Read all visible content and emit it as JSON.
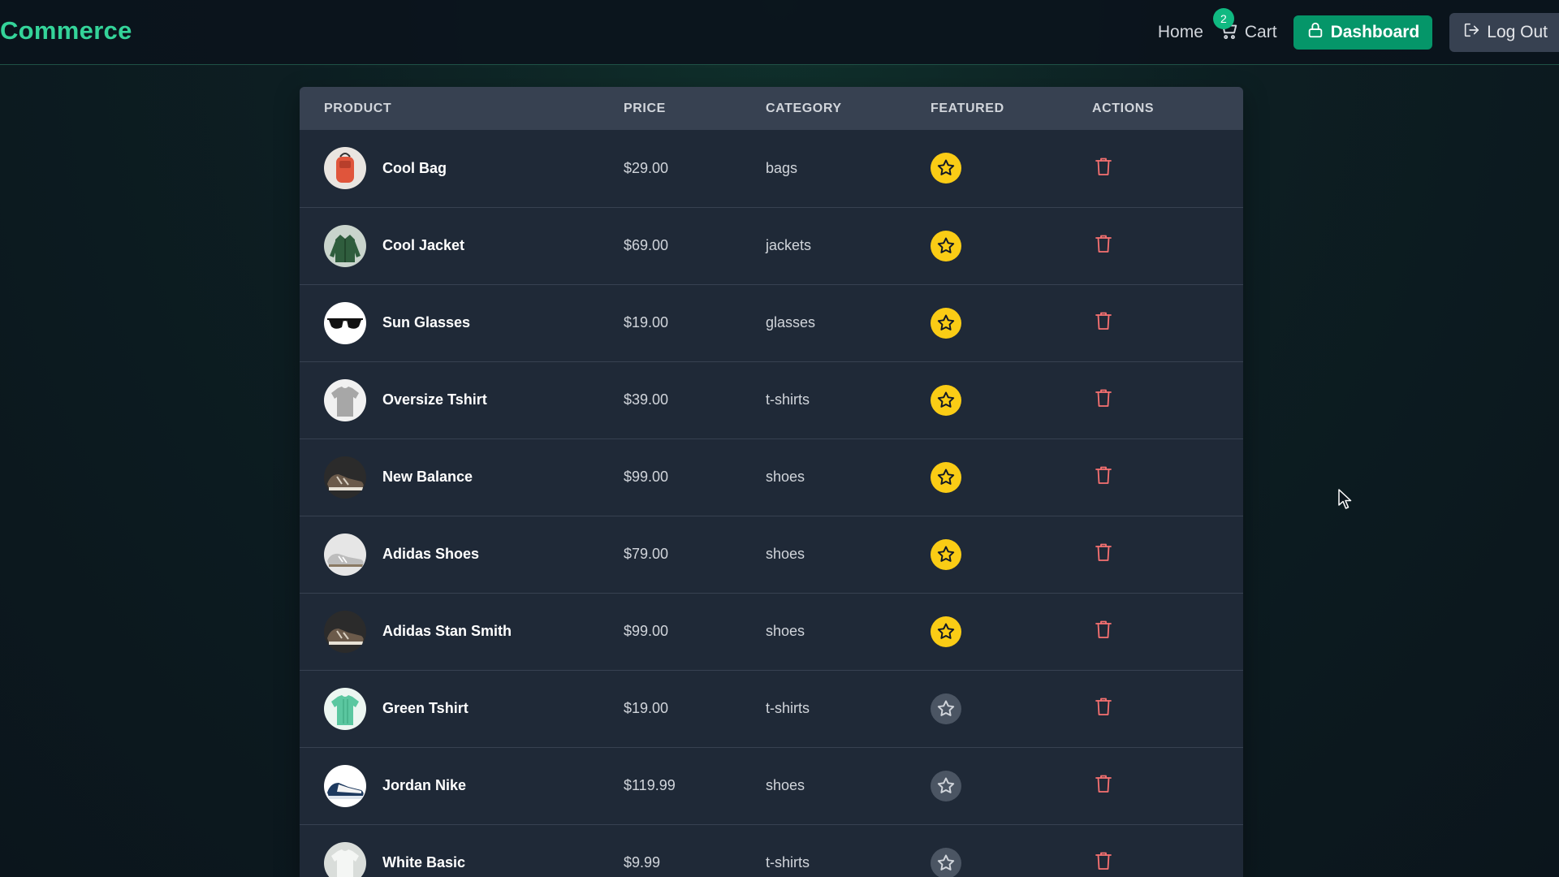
{
  "nav": {
    "brand": "Commerce",
    "home_label": "Home",
    "cart_label": "Cart",
    "cart_count": "2",
    "dashboard_label": "Dashboard",
    "logout_label": "Log Out"
  },
  "table": {
    "headers": {
      "product": "PRODUCT",
      "price": "PRICE",
      "category": "CATEGORY",
      "featured": "FEATURED",
      "actions": "ACTIONS"
    },
    "rows": [
      {
        "name": "Cool Bag",
        "price": "$29.00",
        "category": "bags",
        "featured": true,
        "thumb": "bag"
      },
      {
        "name": "Cool Jacket",
        "price": "$69.00",
        "category": "jackets",
        "featured": true,
        "thumb": "jacket"
      },
      {
        "name": "Sun Glasses",
        "price": "$19.00",
        "category": "glasses",
        "featured": true,
        "thumb": "glasses"
      },
      {
        "name": "Oversize Tshirt",
        "price": "$39.00",
        "category": "t-shirts",
        "featured": true,
        "thumb": "tshirt-grey"
      },
      {
        "name": "New Balance",
        "price": "$99.00",
        "category": "shoes",
        "featured": true,
        "thumb": "shoe-dark"
      },
      {
        "name": "Adidas Shoes",
        "price": "$79.00",
        "category": "shoes",
        "featured": true,
        "thumb": "shoe-light"
      },
      {
        "name": "Adidas Stan Smith",
        "price": "$99.00",
        "category": "shoes",
        "featured": true,
        "thumb": "shoe-dark"
      },
      {
        "name": "Green Tshirt",
        "price": "$19.00",
        "category": "t-shirts",
        "featured": false,
        "thumb": "tshirt-green"
      },
      {
        "name": "Jordan Nike",
        "price": "$119.99",
        "category": "shoes",
        "featured": false,
        "thumb": "shoe-blue"
      },
      {
        "name": "White Basic",
        "price": "$9.99",
        "category": "t-shirts",
        "featured": false,
        "thumb": "tshirt-white"
      }
    ]
  },
  "colors": {
    "accent": "#10b981",
    "brand_text": "#34d399",
    "star_on": "#facc15",
    "star_off": "#4b5563",
    "trash": "#f87171"
  }
}
